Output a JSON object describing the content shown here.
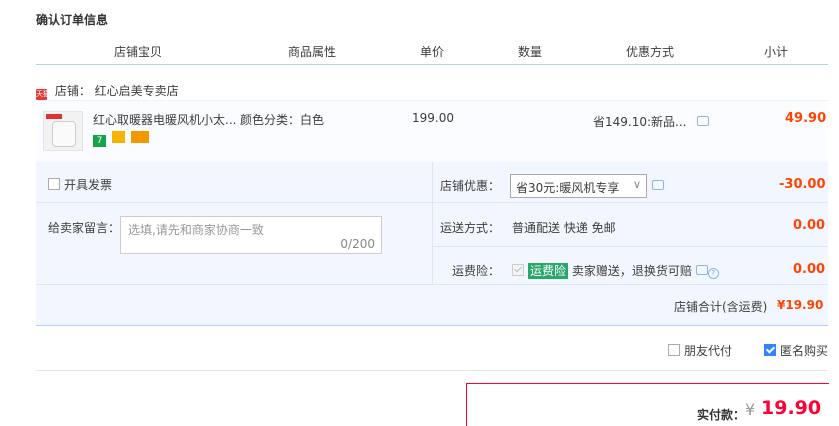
{
  "page_title": "确认订单信息",
  "columns": [
    "店铺宝贝",
    "商品属性",
    "单价",
    "数量",
    "优惠方式",
    "小计"
  ],
  "shop": {
    "label": "店铺：",
    "name": "红心启美专卖店",
    "logo_text": "天猫"
  },
  "item": {
    "name": "红心取暖器电暖风机小太...",
    "attr": "颜色分类：白色",
    "price": "199.00",
    "discount": "省149.10:新品...",
    "subtotal": "49.90",
    "badges": [
      "7",
      "",
      ""
    ]
  },
  "invoice": {
    "label": "开具发票"
  },
  "shop_discount": {
    "label": "店铺优惠：",
    "selected": "省30元:暖风机专享",
    "value": "-30.00"
  },
  "message": {
    "label": "给卖家留言：",
    "placeholder": "选填,请先和商家协商一致",
    "counter": "0/200"
  },
  "shipping": {
    "label": "运送方式：",
    "value": "普通配送 快递 免邮",
    "amount": "0.00"
  },
  "insurance": {
    "label": "运费险：",
    "badge": "运费险",
    "text": "卖家赠送，退换货可赔",
    "amount": "0.00"
  },
  "shop_total": {
    "label": "店铺合计(含运费)",
    "value": "¥19.90"
  },
  "options": {
    "friend_pay": "朋友代付",
    "anonymous": "匿名购买"
  },
  "payment": {
    "label": "实付款：",
    "currency": "¥",
    "amount": "19.90"
  },
  "colors": {
    "accent_red": "#ff4400",
    "border_blue": "#b2d1ff",
    "panel_bg": "#f2f7ff",
    "insure_green": "#2aa66a"
  }
}
